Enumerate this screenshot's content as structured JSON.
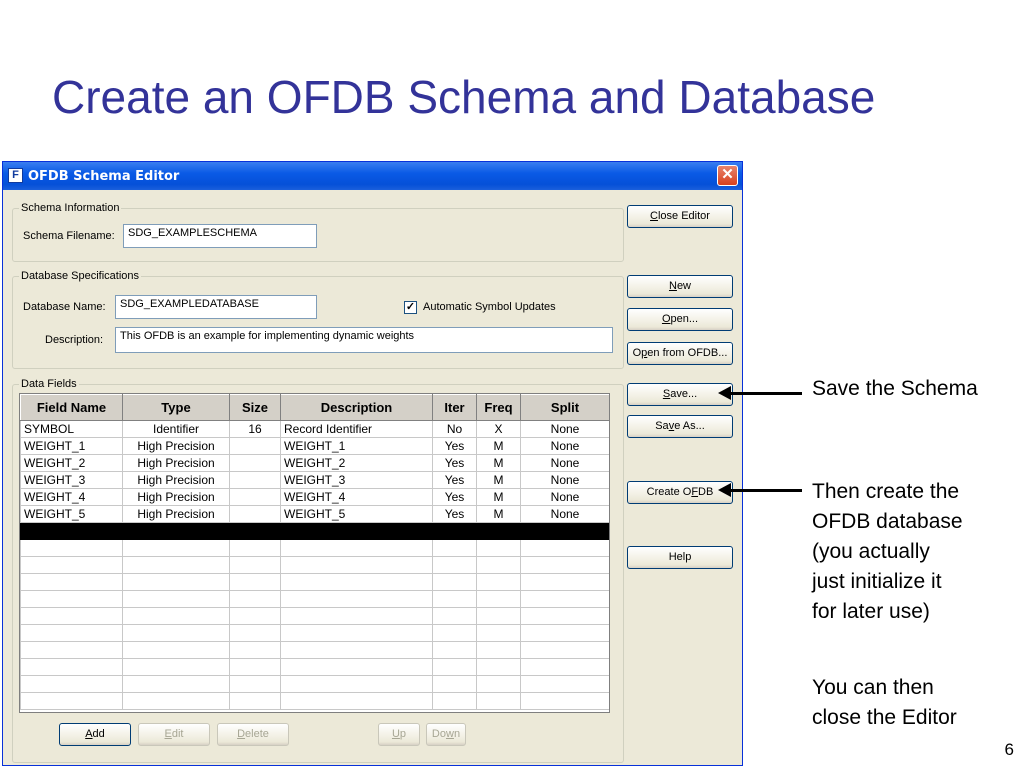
{
  "slide": {
    "title": "Create an OFDB Schema and Database",
    "page_number": "6",
    "annotations": {
      "save": "Save the Schema",
      "create": [
        "Then create the",
        "OFDB database",
        "(you actually",
        "just initialize it",
        "for later use)"
      ],
      "close": [
        "You can then",
        "close the Editor"
      ]
    }
  },
  "window": {
    "title": "OFDB Schema Editor",
    "icon_letter": "F",
    "close_glyph": "✕"
  },
  "schema_info": {
    "legend": "Schema Information",
    "filename_label": "Schema Filename:",
    "filename_value": "SDG_EXAMPLESCHEMA"
  },
  "db_spec": {
    "legend": "Database Specifications",
    "name_label": "Database Name:",
    "name_value": "SDG_EXAMPLEDATABASE",
    "auto_updates_label": "Automatic Symbol Updates",
    "auto_updates_checked": true,
    "description_label": "Description:",
    "description_value": "This OFDB is an example for implementing dynamic weights"
  },
  "data_fields": {
    "legend": "Data Fields",
    "columns": [
      "Field Name",
      "Type",
      "Size",
      "Description",
      "Iter",
      "Freq",
      "Split"
    ],
    "rows": [
      [
        "SYMBOL",
        "Identifier",
        "16",
        "Record Identifier",
        "No",
        "X",
        "None"
      ],
      [
        "WEIGHT_1",
        "High Precision",
        "",
        "WEIGHT_1",
        "Yes",
        "M",
        "None"
      ],
      [
        "WEIGHT_2",
        "High Precision",
        "",
        "WEIGHT_2",
        "Yes",
        "M",
        "None"
      ],
      [
        "WEIGHT_3",
        "High Precision",
        "",
        "WEIGHT_3",
        "Yes",
        "M",
        "None"
      ],
      [
        "WEIGHT_4",
        "High Precision",
        "",
        "WEIGHT_4",
        "Yes",
        "M",
        "None"
      ],
      [
        "WEIGHT_5",
        "High Precision",
        "",
        "WEIGHT_5",
        "Yes",
        "M",
        "None"
      ]
    ],
    "buttons": {
      "add": {
        "pre": "",
        "ul": "A",
        "post": "dd"
      },
      "edit": {
        "pre": "",
        "ul": "E",
        "post": "dit"
      },
      "delete": {
        "pre": "",
        "ul": "D",
        "post": "elete"
      },
      "up": {
        "pre": "",
        "ul": "U",
        "post": "p"
      },
      "down": {
        "pre": "Do",
        "ul": "w",
        "post": "n"
      }
    }
  },
  "side_buttons": {
    "close_editor": {
      "pre": "",
      "ul": "C",
      "post": "lose Editor"
    },
    "new": {
      "pre": "",
      "ul": "N",
      "post": "ew"
    },
    "open": {
      "pre": "",
      "ul": "O",
      "post": "pen..."
    },
    "open_from_ofdb": {
      "pre": "O",
      "ul": "p",
      "post": "en from OFDB..."
    },
    "save": {
      "pre": "",
      "ul": "S",
      "post": "ave..."
    },
    "save_as": {
      "pre": "Sa",
      "ul": "v",
      "post": "e As..."
    },
    "create_ofdb": {
      "pre": "Create O",
      "ul": "F",
      "post": "DB"
    },
    "help": {
      "pre": "",
      "ul": "",
      "post": "Help"
    }
  }
}
